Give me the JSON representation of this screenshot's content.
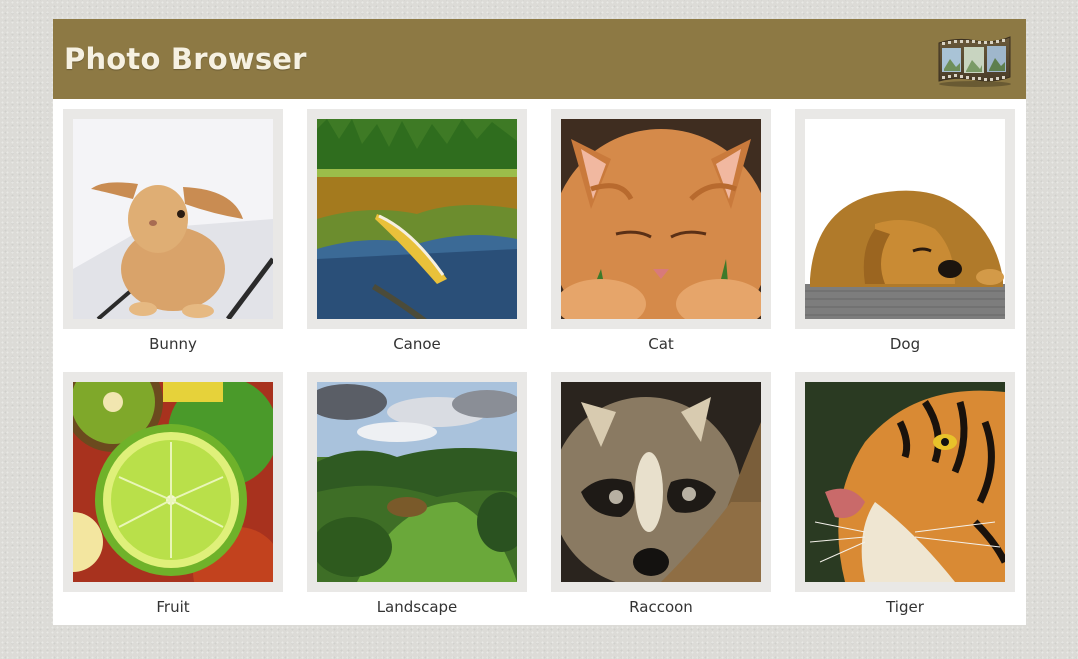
{
  "header": {
    "title": "Photo Browser",
    "icon": "film-strip-icon",
    "background_color": "#8d7944"
  },
  "photos": [
    {
      "caption": "Bunny",
      "icon": "bunny-photo"
    },
    {
      "caption": "Canoe",
      "icon": "canoe-photo"
    },
    {
      "caption": "Cat",
      "icon": "cat-photo"
    },
    {
      "caption": "Dog",
      "icon": "dog-photo"
    },
    {
      "caption": "Fruit",
      "icon": "fruit-photo"
    },
    {
      "caption": "Landscape",
      "icon": "landscape-photo"
    },
    {
      "caption": "Raccoon",
      "icon": "raccoon-photo"
    },
    {
      "caption": "Tiger",
      "icon": "tiger-photo"
    }
  ]
}
